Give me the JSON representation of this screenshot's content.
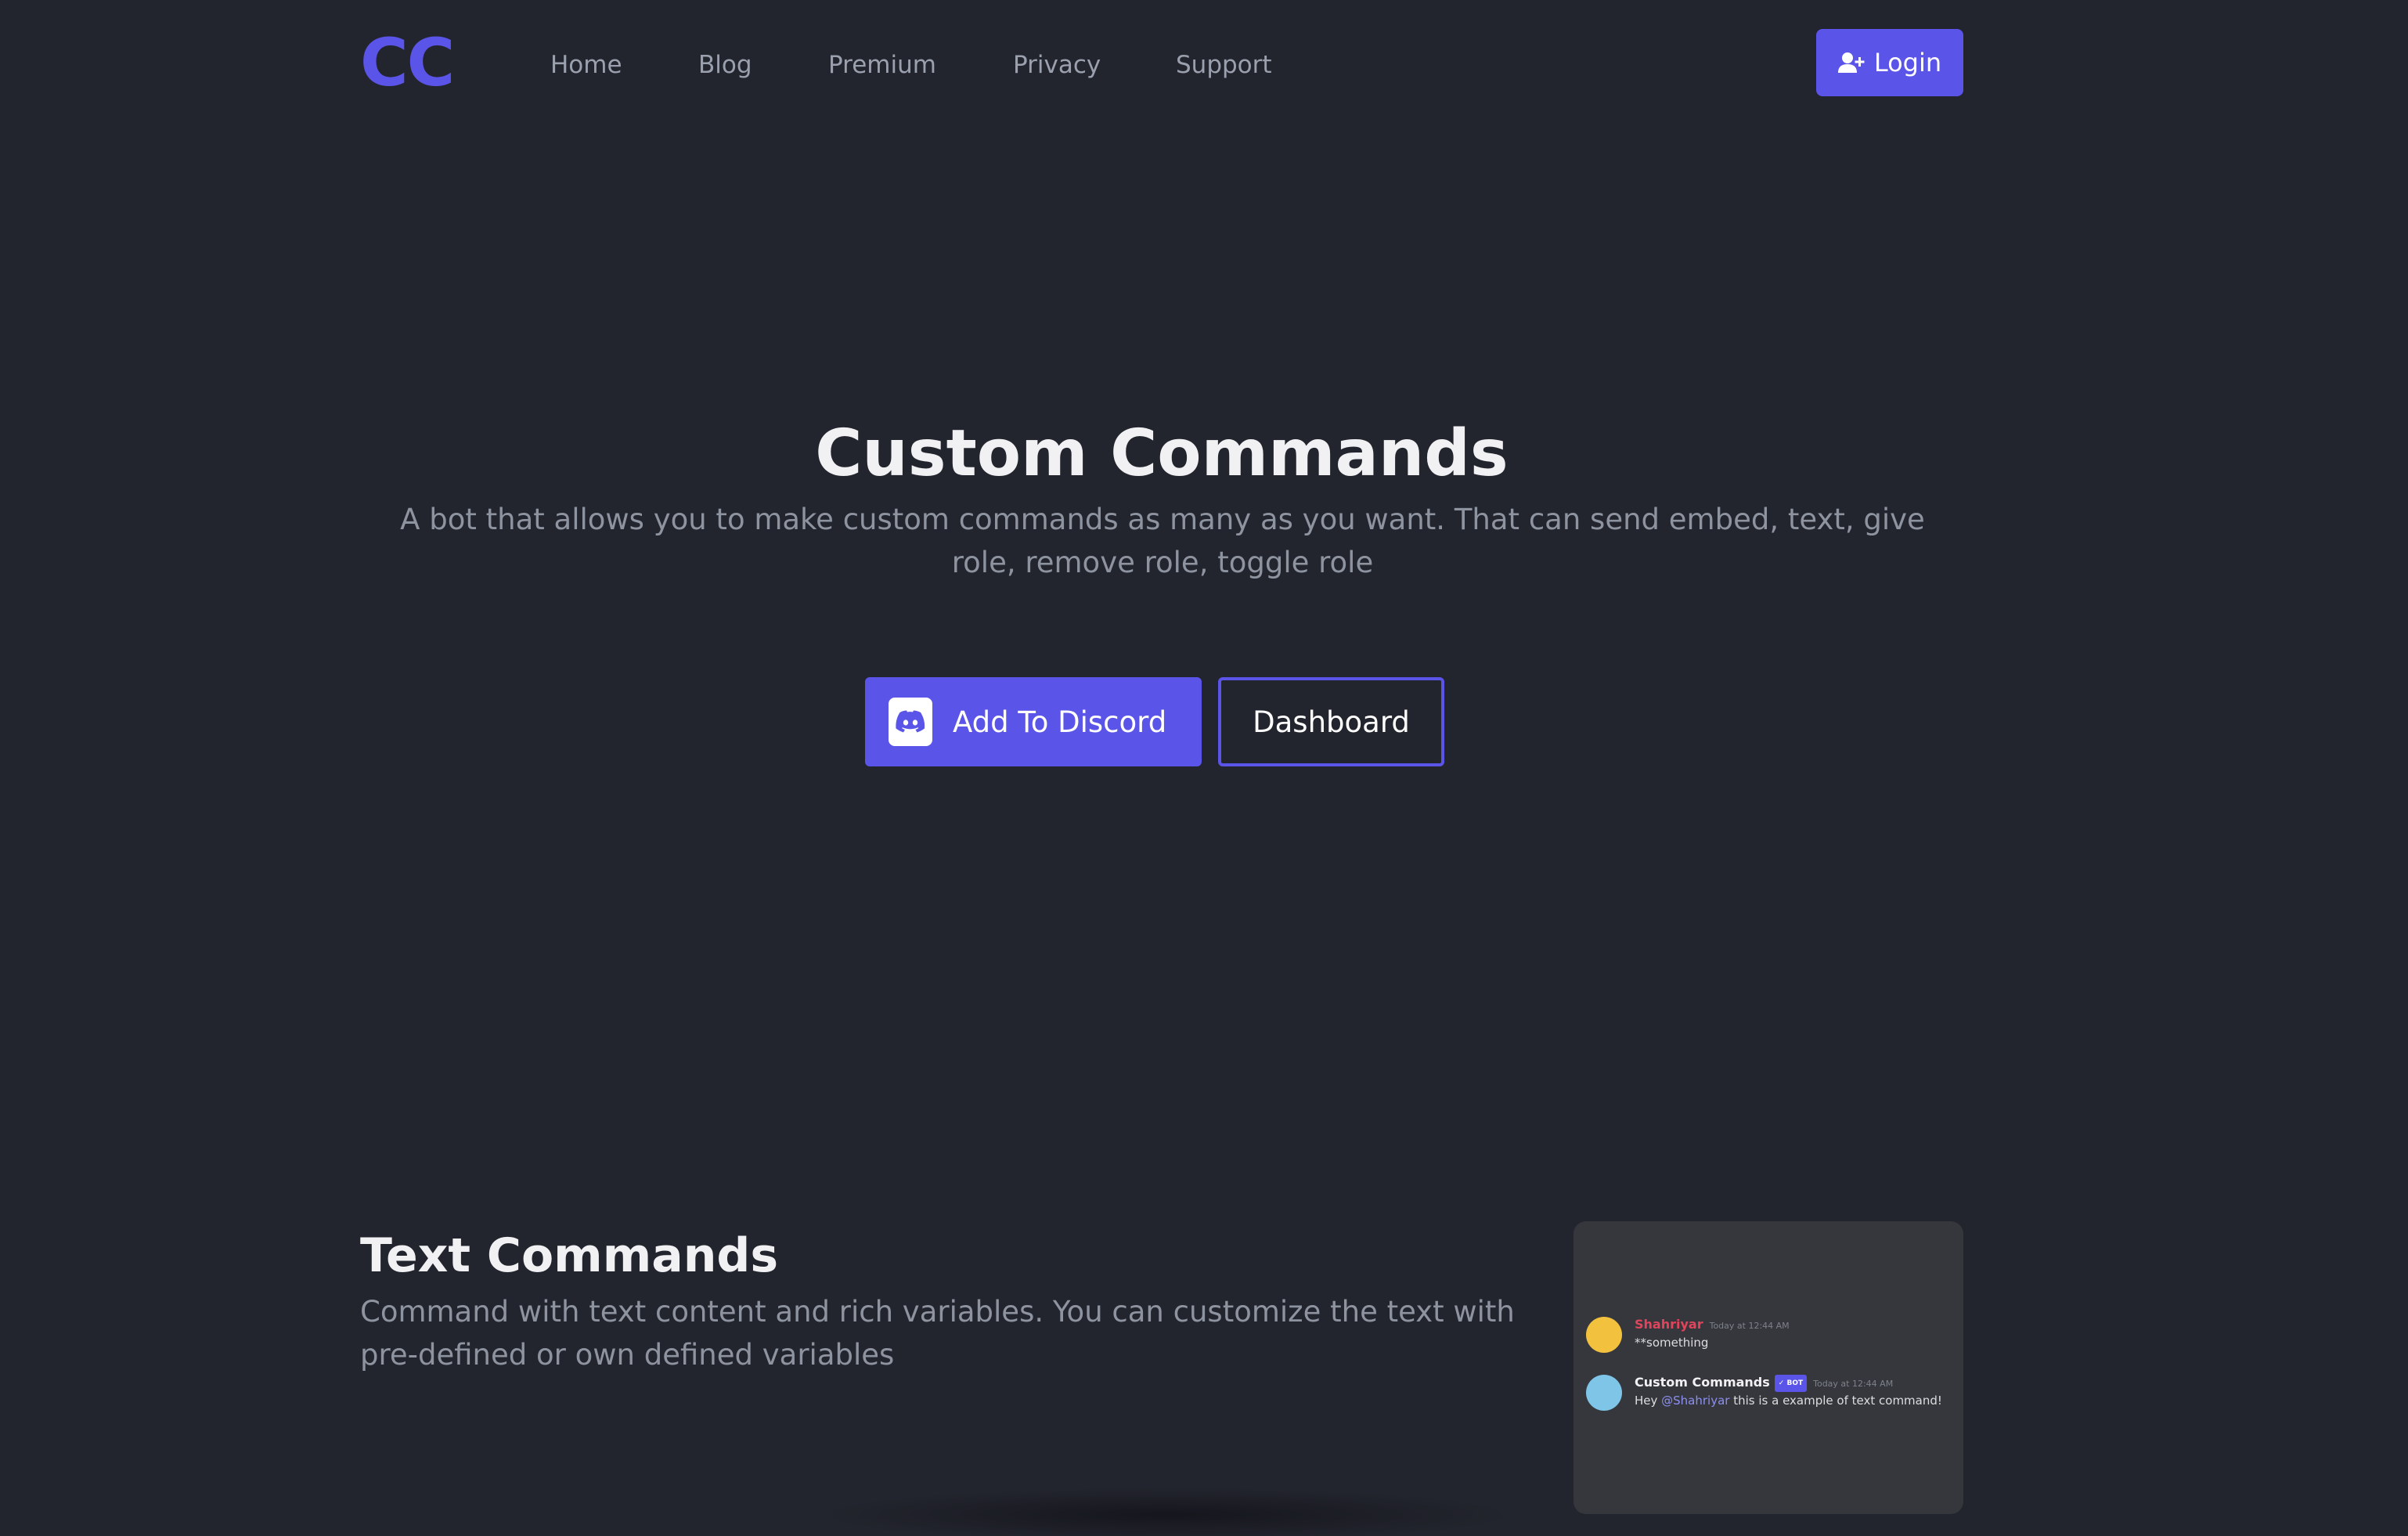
{
  "header": {
    "logo": "CC",
    "nav": [
      "Home",
      "Blog",
      "Premium",
      "Privacy",
      "Support"
    ],
    "login_label": "Login",
    "login_icon": "user-plus-icon"
  },
  "hero": {
    "title": "Custom Commands",
    "subtitle": "A bot that allows you to make custom commands as many as you want. That can send embed, text, give role, remove role, toggle role",
    "add_label": "Add To Discord",
    "add_icon": "discord-icon",
    "dashboard_label": "Dashboard"
  },
  "feature": {
    "title": "Text Commands",
    "description": "Command with text content and rich variables. You can customize the text with pre-defined or own defined variables",
    "preview": {
      "msg1": {
        "name": "Shahriyar",
        "time": "Today at 12:44 AM",
        "text": "**something"
      },
      "msg2": {
        "name": "Custom Commands",
        "badge": "✓ BOT",
        "time": "Today at 12:44 AM",
        "text_prefix": "Hey ",
        "mention": "@Shahriyar",
        "text_suffix": " this is a example of text command!"
      }
    }
  },
  "colors": {
    "accent": "#5b54e8",
    "background": "#23252e"
  }
}
